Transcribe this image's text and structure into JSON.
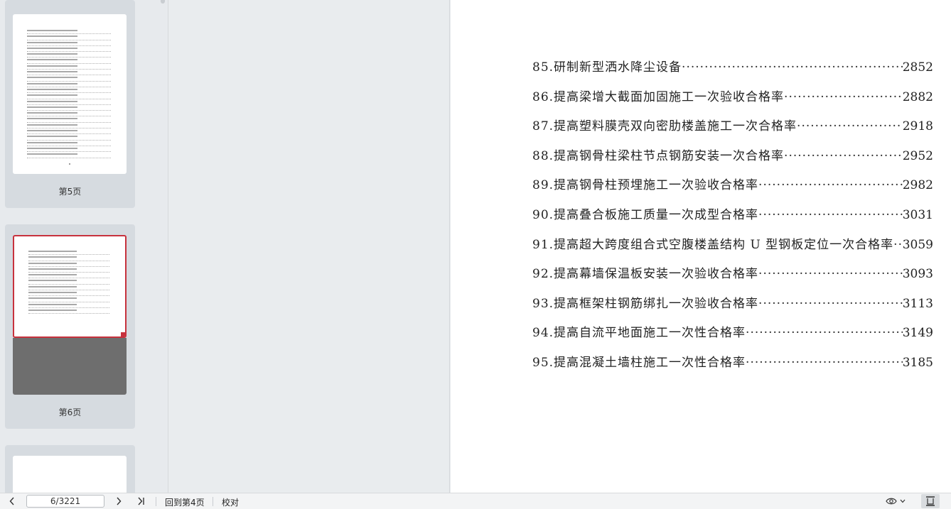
{
  "sidebar": {
    "thumbnails": [
      {
        "label": "第5页",
        "selected": false
      },
      {
        "label": "第6页",
        "selected": true
      },
      {
        "label": "",
        "selected": false
      }
    ]
  },
  "document": {
    "toc": [
      {
        "title": "85.研制新型洒水降尘设备",
        "page": "2852"
      },
      {
        "title": "86.提高梁增大截面加固施工一次验收合格率",
        "page": "2882"
      },
      {
        "title": "87.提高塑料膜壳双向密肋楼盖施工一次合格率",
        "page": "2918"
      },
      {
        "title": "88.提高钢骨柱梁柱节点钢筋安装一次合格率",
        "page": "2952"
      },
      {
        "title": "89.提高钢骨柱预埋施工一次验收合格率",
        "page": "2982"
      },
      {
        "title": "90.提高叠合板施工质量一次成型合格率",
        "page": "3031"
      },
      {
        "title": "91.提高超大跨度组合式空腹楼盖结构 U 型钢板定位一次合格率",
        "page": "3059"
      },
      {
        "title": "92.提高幕墙保温板安装一次验收合格率",
        "page": "3093"
      },
      {
        "title": "93.提高框架柱钢筋绑扎一次验收合格率",
        "page": "3113"
      },
      {
        "title": "94.提高自流平地面施工一次性合格率",
        "page": "3149"
      },
      {
        "title": "95.提高混凝土墙柱施工一次性合格率",
        "page": "3185"
      }
    ]
  },
  "statusbar": {
    "page_value": "6/3221",
    "back_to_label": "回到第4页",
    "proofread_label": "校对",
    "icons": {
      "prev": "chevron-left-icon",
      "next": "chevron-right-icon",
      "last": "skip-to-end-icon",
      "view": "eye-icon",
      "layout": "single-page-icon"
    }
  }
}
